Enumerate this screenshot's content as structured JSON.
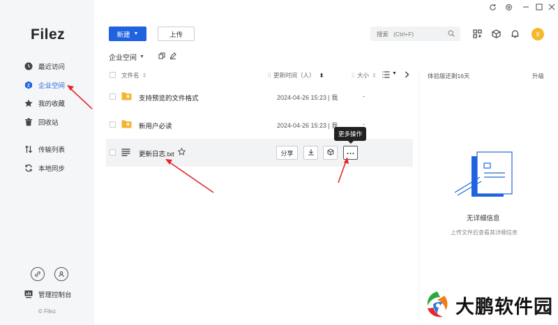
{
  "app": {
    "logo": "Filez",
    "copyright": "© Filez"
  },
  "window_controls": [
    "refresh-icon",
    "settings-icon",
    "minimize-icon",
    "maximize-icon",
    "close-icon"
  ],
  "sidebar": {
    "items": [
      {
        "label": "最近访问",
        "icon": "clock-icon"
      },
      {
        "label": "企业空间",
        "icon": "enterprise-icon",
        "active": true
      },
      {
        "label": "我的收藏",
        "icon": "star-icon"
      },
      {
        "label": "回收站",
        "icon": "trash-icon"
      },
      {
        "label": "传输列表",
        "icon": "transfer-icon"
      },
      {
        "label": "本地同步",
        "icon": "sync-icon"
      }
    ],
    "admin_label": "管理控制台"
  },
  "toolbar": {
    "new_label": "新建",
    "upload_label": "上传",
    "search_placeholder": "搜索   (Ctrl+F)",
    "avatar_text": "8"
  },
  "breadcrumb": {
    "label": "企业空间"
  },
  "table": {
    "col_name": "文件名",
    "col_time": "更新时间（人）",
    "col_size": "大小",
    "rows": [
      {
        "name": "支持预览的文件格式",
        "time": "2024-04-26 15:23 | 我",
        "size": "-",
        "type": "folder"
      },
      {
        "name": "新用户必读",
        "time": "2024-04-26 15:23 | 我",
        "size": "-",
        "type": "folder"
      },
      {
        "name": "更新日志.txt",
        "type": "txt",
        "share_label": "分享"
      }
    ],
    "tooltip": "更多操作"
  },
  "panel": {
    "trial": "体验版还剩16天",
    "upgrade": "升级",
    "empty_title": "无详细信息",
    "empty_sub": "上传文件后查看其详细信息"
  },
  "watermark": {
    "text": "大鹏软件园"
  },
  "colors": {
    "accent": "#1f63e0",
    "folder": "#f6b431",
    "avatar": "#f6b82a",
    "annotation": "#e8262a"
  }
}
